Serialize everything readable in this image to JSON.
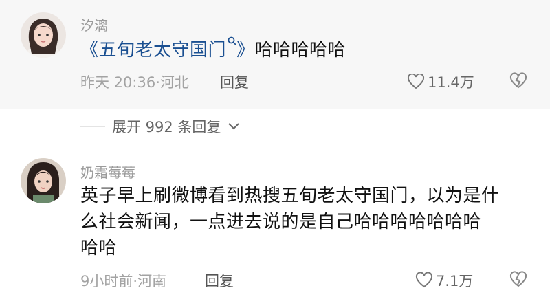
{
  "comments": [
    {
      "username": "汐漓",
      "tag_open": "《",
      "tag_text": "五旬老太守国门",
      "tag_close": "》",
      "body_after_tag": "哈哈哈哈哈",
      "time": "昨天 20:36",
      "dot": "·",
      "location": "河北",
      "reply_label": "回复",
      "likes": "11.4万"
    },
    {
      "username": "奶霜莓莓",
      "body_line1": "英子早上刷微博看到热搜五旬老太守国门，以为是什",
      "body_line2": "么社会新闻，一点进去说的是自己哈哈哈哈哈哈哈",
      "body_line3": "哈哈",
      "time": "9小时前",
      "dot": "·",
      "location": "河南",
      "reply_label": "回复",
      "likes": "7.1万"
    }
  ],
  "expand": {
    "label": "展开 992 条回复"
  },
  "icons": {
    "like": "heart-outline-icon",
    "dislike": "broken-heart-icon",
    "search": "search-icon",
    "expand": "chevron-down-icon"
  },
  "colors": {
    "tag_link": "#1a4f91",
    "meta_gray": "#a3a3a3",
    "first_comment_bg": "#f7f7f7"
  }
}
